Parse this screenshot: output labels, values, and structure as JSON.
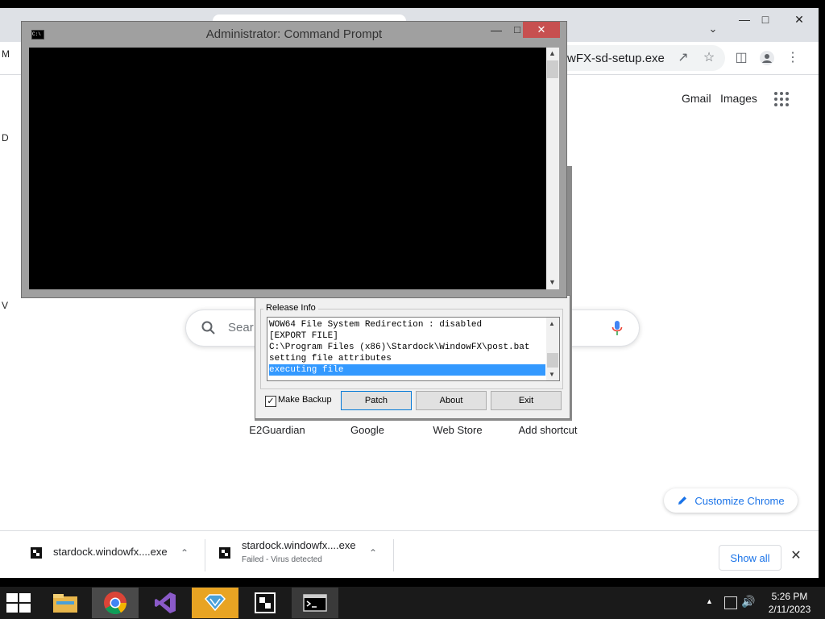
{
  "chrome": {
    "url_fragment": "wFX-sd-setup.exe",
    "links": {
      "gmail": "Gmail",
      "images": "Images"
    },
    "search_placeholder": "Sear",
    "left_strip_letters": [
      "M",
      "D",
      "V"
    ],
    "shortcuts": [
      "E2Guardian",
      "Google",
      "Web Store",
      "Add shortcut"
    ],
    "customize_label": "Customize Chrome",
    "accent_color": "#1a73e8"
  },
  "downloads": {
    "items": [
      {
        "name": "stardock.windowfx....exe",
        "status": ""
      },
      {
        "name": "stardock.windowfx....exe",
        "status": "Failed - Virus detected"
      }
    ],
    "show_all": "Show all"
  },
  "patcher": {
    "group_label": "Release Info",
    "log_lines": [
      "WOW64 File System Redirection : disabled",
      "[EXPORT FILE]",
      "C:\\Program Files (x86)\\Stardock\\WindowFX\\post.bat",
      "setting file attributes",
      "executing file"
    ],
    "selected_line": 4,
    "make_backup_label": "Make Backup",
    "make_backup_checked": true,
    "buttons": {
      "patch": "Patch",
      "about": "About",
      "exit": "Exit"
    },
    "selection_color": "#3399ff"
  },
  "cmd": {
    "title": "Administrator:  Command Prompt",
    "icon_text": "C:\\"
  },
  "taskbar": {
    "time": "5:26 PM",
    "date": "2/11/2023",
    "apps": [
      "file-explorer",
      "chrome",
      "visual-studio",
      "stardock-app",
      "stardock-patcher",
      "command-prompt"
    ]
  }
}
